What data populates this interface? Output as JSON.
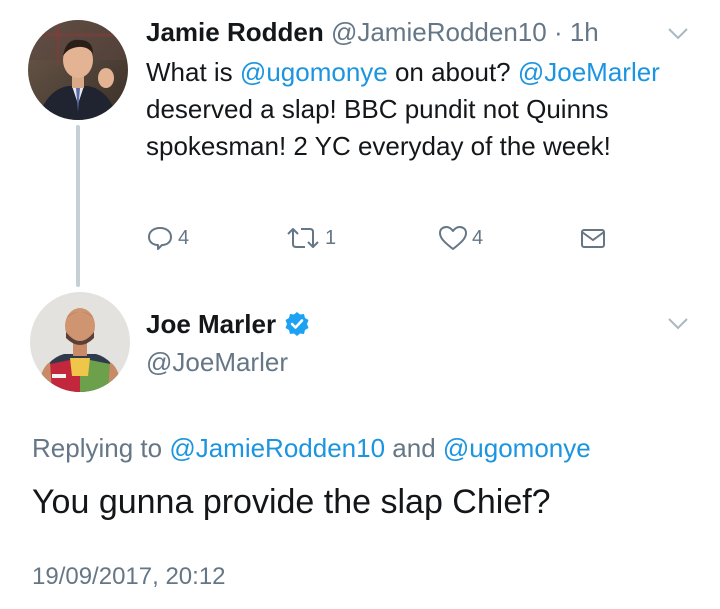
{
  "reply_tweet": {
    "author_name": "Jamie Rodden",
    "author_handle": "@JamieRodden10",
    "separator": "·",
    "time": "1h",
    "body": {
      "part1": "What is ",
      "mention1": "@ugomonye",
      "part2": " on about? ",
      "mention2": "@JoeMarler",
      "part3": " deserved a slap! BBC pundit not Quinns spokesman! 2 YC everyday of the week!"
    },
    "actions": {
      "reply_icon": "reply-icon",
      "reply_count": "4",
      "retweet_icon": "retweet-icon",
      "retweet_count": "1",
      "like_icon": "heart-icon",
      "like_count": "4",
      "dm_icon": "envelope-icon"
    }
  },
  "main_tweet": {
    "author_name": "Joe Marler",
    "verified_icon": "verified-badge-icon",
    "author_handle": "@JoeMarler",
    "replying_prefix": "Replying to ",
    "replying_mention1": "@JamieRodden10",
    "replying_and": " and ",
    "replying_mention2": "@ugomonye",
    "text": "You gunna provide the slap Chief?",
    "timestamp": "19/09/2017, 20:12"
  },
  "colors": {
    "link": "#1b95e0",
    "secondary_text": "#657786",
    "primary_text": "#14171a",
    "thread_line": "#c4cfd6"
  }
}
